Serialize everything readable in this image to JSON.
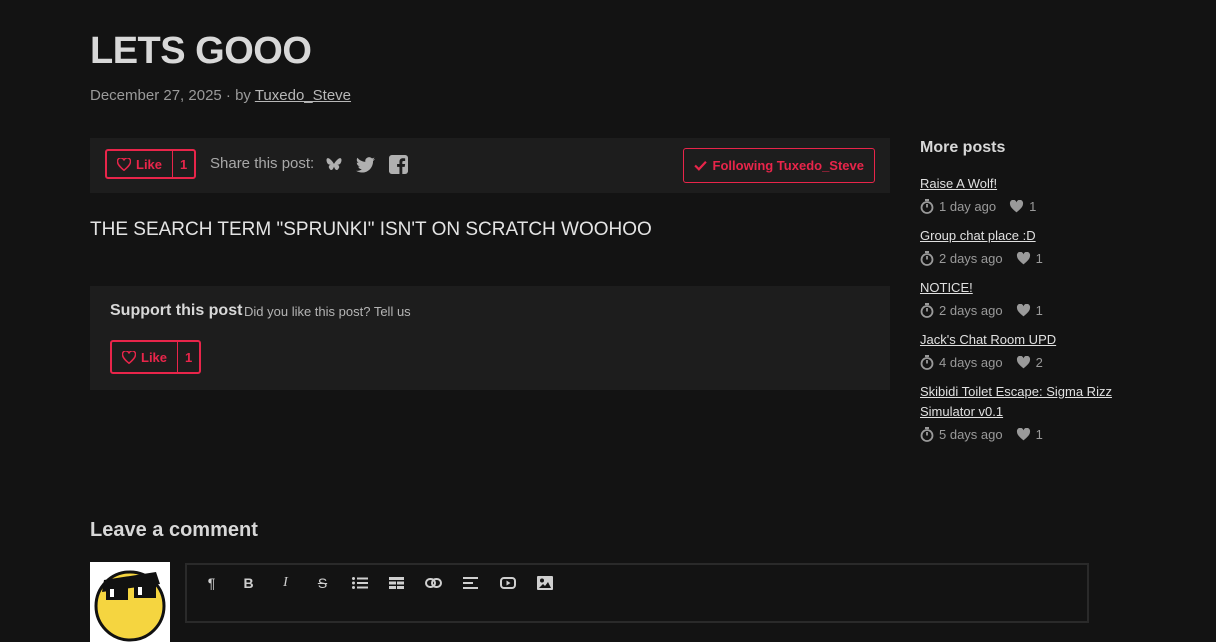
{
  "post": {
    "title": "LETS GOOO",
    "date": "December 27, 2025",
    "by": " · by ",
    "author": "Tuxedo_Steve",
    "body": "THE SEARCH TERM \"SPRUNKI\" ISN'T ON SCRATCH WOOHOO"
  },
  "toolbar": {
    "like_label": "Like",
    "like_count": "1",
    "share_label": "Share this post:",
    "follow_label": "Following Tuxedo_Steve"
  },
  "support": {
    "title": "Support this post",
    "subtitle": "Did you like this post? Tell us",
    "like_label": "Like",
    "like_count": "1"
  },
  "sidebar": {
    "heading": "More posts",
    "posts": [
      {
        "title": "Raise A Wolf!",
        "age": "1 day ago",
        "likes": "1"
      },
      {
        "title": "Group chat place :D",
        "age": "2 days ago",
        "likes": "1"
      },
      {
        "title": "NOTICE!",
        "age": "2 days ago",
        "likes": "1"
      },
      {
        "title": "Jack's Chat Room UPD",
        "age": "4 days ago",
        "likes": "2"
      },
      {
        "title": "Skibidi Toilet Escape: Sigma Rizz Simulator v0.1",
        "age": "5 days ago",
        "likes": "1"
      }
    ]
  },
  "comment": {
    "heading": "Leave a comment",
    "tools": [
      "paragraph-icon",
      "bold-icon",
      "italic-icon",
      "strikethrough-icon",
      "bullet-list-icon",
      "table-icon",
      "link-icon",
      "align-icon",
      "youtube-icon",
      "image-icon"
    ]
  },
  "colors": {
    "accent": "#e8254a",
    "background": "#131313",
    "panel": "#1d1d1d"
  }
}
